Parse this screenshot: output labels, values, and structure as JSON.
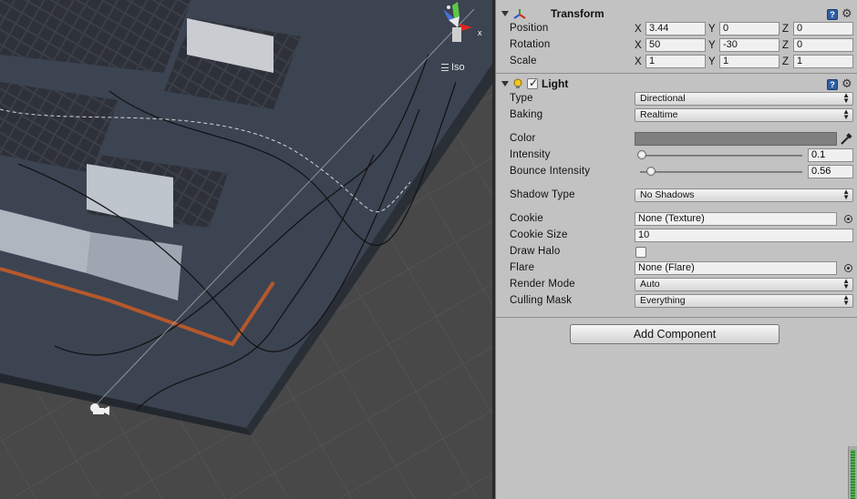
{
  "scene": {
    "projection_label": "Iso",
    "gizmo_axis_label": "x"
  },
  "inspector": {
    "transform": {
      "title": "Transform",
      "position": {
        "label": "Position",
        "x": "3.44",
        "y": "0",
        "z": "0"
      },
      "rotation": {
        "label": "Rotation",
        "x": "50",
        "y": "-30",
        "z": "0"
      },
      "scale": {
        "label": "Scale",
        "x": "1",
        "y": "1",
        "z": "1"
      },
      "axis_x": "X",
      "axis_y": "Y",
      "axis_z": "Z"
    },
    "light": {
      "title": "Light",
      "enabled": true,
      "type": {
        "label": "Type",
        "value": "Directional"
      },
      "baking": {
        "label": "Baking",
        "value": "Realtime"
      },
      "color": {
        "label": "Color",
        "value": "#808080"
      },
      "intensity": {
        "label": "Intensity",
        "value": "0.1",
        "fraction": 0.0125
      },
      "bounce_intensity": {
        "label": "Bounce Intensity",
        "value": "0.56",
        "fraction": 0.07
      },
      "shadow_type": {
        "label": "Shadow Type",
        "value": "No Shadows"
      },
      "cookie": {
        "label": "Cookie",
        "value": "None (Texture)"
      },
      "cookie_size": {
        "label": "Cookie Size",
        "value": "10"
      },
      "draw_halo": {
        "label": "Draw Halo",
        "checked": false
      },
      "flare": {
        "label": "Flare",
        "value": "None (Flare)"
      },
      "render_mode": {
        "label": "Render Mode",
        "value": "Auto"
      },
      "culling_mask": {
        "label": "Culling Mask",
        "value": "Everything"
      }
    },
    "add_component_label": "Add Component"
  }
}
